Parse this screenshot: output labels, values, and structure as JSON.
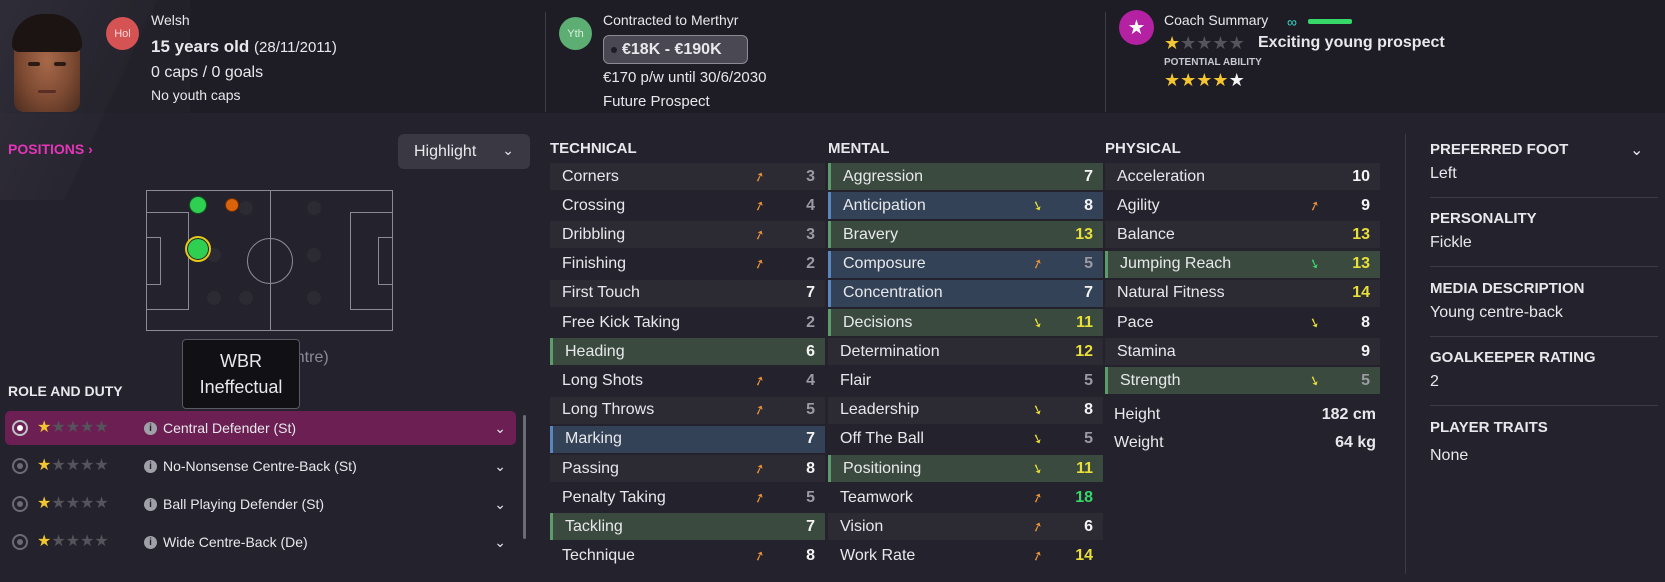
{
  "header": {
    "nationality": "Welsh",
    "nation_badge": "Hol",
    "age_text": "15 years old",
    "dob": "(28/11/2011)",
    "caps": "0 caps / 0 goals",
    "youth_caps": "No youth caps",
    "squad_badge": "Yth",
    "contract": "Contracted to Merthyr",
    "wage_range": "€18K - €190K",
    "wage_detail": "€170 p/w until 30/6/2030",
    "status": "Future Prospect",
    "coach_summary_label": "Coach Summary",
    "coach_summary_text": "Exciting young prospect",
    "potential_label": "POTENTIAL ABILITY",
    "current_stars": 1.5,
    "potential_stars": 4.5
  },
  "positions": {
    "title": "POSITIONS",
    "highlight_label": "Highlight",
    "tooltip_line1": "WBR",
    "tooltip_line2": "Ineffectual",
    "behind_text": "(Centre)"
  },
  "role_duty": {
    "title": "ROLE AND DUTY",
    "roles": [
      {
        "name": "Central Defender (St)",
        "stars": 1.5,
        "selected": true
      },
      {
        "name": "No-Nonsense Centre-Back (St)",
        "stars": 1.5,
        "selected": false
      },
      {
        "name": "Ball Playing Defender (St)",
        "stars": 1.5,
        "selected": false
      },
      {
        "name": "Wide Centre-Back (De)",
        "stars": 1,
        "selected": false
      }
    ]
  },
  "technical": {
    "title": "TECHNICAL",
    "items": [
      {
        "name": "Corners",
        "value": "3",
        "arrow": "orange",
        "hl": ""
      },
      {
        "name": "Crossing",
        "value": "4",
        "arrow": "orange",
        "hl": ""
      },
      {
        "name": "Dribbling",
        "value": "3",
        "arrow": "orange",
        "hl": ""
      },
      {
        "name": "Finishing",
        "value": "2",
        "arrow": "orange",
        "hl": ""
      },
      {
        "name": "First Touch",
        "value": "7",
        "arrow": "",
        "hl": ""
      },
      {
        "name": "Free Kick Taking",
        "value": "2",
        "arrow": "",
        "hl": ""
      },
      {
        "name": "Heading",
        "value": "6",
        "arrow": "",
        "hl": "green"
      },
      {
        "name": "Long Shots",
        "value": "4",
        "arrow": "orange",
        "hl": ""
      },
      {
        "name": "Long Throws",
        "value": "5",
        "arrow": "orange",
        "hl": ""
      },
      {
        "name": "Marking",
        "value": "7",
        "arrow": "",
        "hl": "blue"
      },
      {
        "name": "Passing",
        "value": "8",
        "arrow": "orange",
        "hl": ""
      },
      {
        "name": "Penalty Taking",
        "value": "5",
        "arrow": "orange",
        "hl": ""
      },
      {
        "name": "Tackling",
        "value": "7",
        "arrow": "",
        "hl": "green"
      },
      {
        "name": "Technique",
        "value": "8",
        "arrow": "orange",
        "hl": ""
      }
    ]
  },
  "mental": {
    "title": "MENTAL",
    "items": [
      {
        "name": "Aggression",
        "value": "7",
        "arrow": "",
        "hl": "green"
      },
      {
        "name": "Anticipation",
        "value": "8",
        "arrow": "yellow",
        "hl": "blue"
      },
      {
        "name": "Bravery",
        "value": "13",
        "arrow": "",
        "hl": "green"
      },
      {
        "name": "Composure",
        "value": "5",
        "arrow": "orange",
        "hl": "blue"
      },
      {
        "name": "Concentration",
        "value": "7",
        "arrow": "",
        "hl": "blue"
      },
      {
        "name": "Decisions",
        "value": "11",
        "arrow": "yellow",
        "hl": "green"
      },
      {
        "name": "Determination",
        "value": "12",
        "arrow": "",
        "hl": ""
      },
      {
        "name": "Flair",
        "value": "5",
        "arrow": "",
        "hl": ""
      },
      {
        "name": "Leadership",
        "value": "8",
        "arrow": "yellow",
        "hl": ""
      },
      {
        "name": "Off The Ball",
        "value": "5",
        "arrow": "yellow",
        "hl": ""
      },
      {
        "name": "Positioning",
        "value": "11",
        "arrow": "yellow",
        "hl": "green"
      },
      {
        "name": "Teamwork",
        "value": "18",
        "arrow": "orange",
        "hl": ""
      },
      {
        "name": "Vision",
        "value": "6",
        "arrow": "orange",
        "hl": ""
      },
      {
        "name": "Work Rate",
        "value": "14",
        "arrow": "orange",
        "hl": ""
      }
    ]
  },
  "physical": {
    "title": "PHYSICAL",
    "items": [
      {
        "name": "Acceleration",
        "value": "10",
        "arrow": "",
        "hl": ""
      },
      {
        "name": "Agility",
        "value": "9",
        "arrow": "orange",
        "hl": ""
      },
      {
        "name": "Balance",
        "value": "13",
        "arrow": "",
        "hl": ""
      },
      {
        "name": "Jumping Reach",
        "value": "13",
        "arrow": "green",
        "hl": "green"
      },
      {
        "name": "Natural Fitness",
        "value": "14",
        "arrow": "",
        "hl": ""
      },
      {
        "name": "Pace",
        "value": "8",
        "arrow": "yellow",
        "hl": ""
      },
      {
        "name": "Stamina",
        "value": "9",
        "arrow": "",
        "hl": ""
      },
      {
        "name": "Strength",
        "value": "5",
        "arrow": "yellow",
        "hl": "green"
      }
    ],
    "height_label": "Height",
    "height_value": "182 cm",
    "weight_label": "Weight",
    "weight_value": "64 kg"
  },
  "info": {
    "preferred_foot_label": "PREFERRED FOOT",
    "preferred_foot": "Left",
    "personality_label": "PERSONALITY",
    "personality": "Fickle",
    "media_label": "MEDIA DESCRIPTION",
    "media": "Young centre-back",
    "gk_label": "GOALKEEPER RATING",
    "gk": "2",
    "traits_label": "PLAYER TRAITS",
    "traits": "None"
  },
  "colors": {
    "background": "#24222c",
    "header_bg": "#1e1d25",
    "accent_pink": "#e535b8",
    "selected_role": "#6b1f52",
    "value_yellow": "#e8df3a",
    "value_green": "#37d86a",
    "arrow_orange": "#e8923a"
  }
}
